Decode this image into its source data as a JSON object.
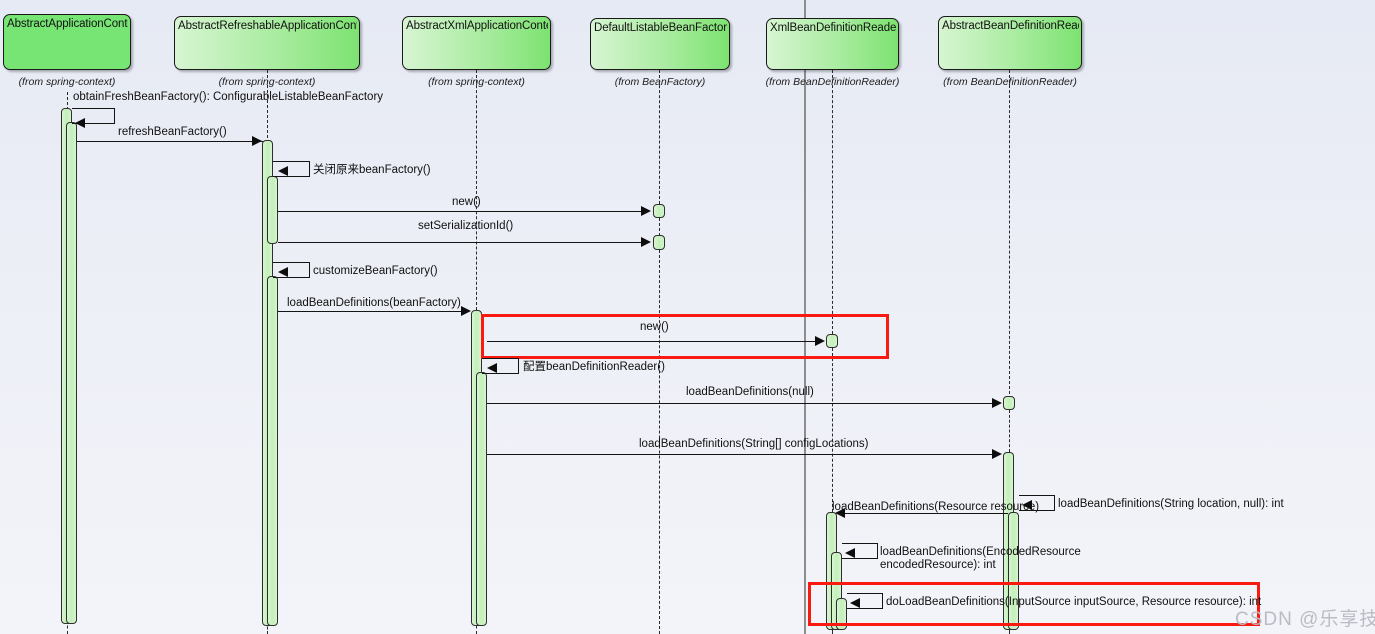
{
  "diagram": {
    "type": "uml-sequence-diagram",
    "background_color": "#e8ecf5",
    "highlight_color": "#fb1a12",
    "lifeline_fill": "#a9eca0"
  },
  "lifelines": [
    {
      "name": "AbstractApplicationContext",
      "package": "(from spring-context)"
    },
    {
      "name": "AbstractRefreshableApplicationContext",
      "package": "(from spring-context)"
    },
    {
      "name": "AbstractXmlApplicationContext",
      "package": "(from spring-context)"
    },
    {
      "name": "DefaultListableBeanFactory",
      "package": "(from BeanFactory)"
    },
    {
      "name": "XmlBeanDefinitionReader",
      "package": "(from BeanDefinitionReader)"
    },
    {
      "name": "AbstractBeanDefinitionReader",
      "package": "(from BeanDefinitionReader)"
    }
  ],
  "messages": [
    {
      "label": "obtainFreshBeanFactory(): ConfigurableListableBeanFactory",
      "kind": "self",
      "from": 0,
      "to": 0
    },
    {
      "label": "refreshBeanFactory()",
      "kind": "call",
      "from": 0,
      "to": 1
    },
    {
      "label": "关闭原来beanFactory()",
      "kind": "self",
      "from": 1,
      "to": 1
    },
    {
      "label": "new()",
      "kind": "create",
      "from": 1,
      "to": 3
    },
    {
      "label": "setSerializationId()",
      "kind": "call",
      "from": 1,
      "to": 3
    },
    {
      "label": "customizeBeanFactory()",
      "kind": "self",
      "from": 1,
      "to": 1
    },
    {
      "label": "loadBeanDefinitions(beanFactory)",
      "kind": "call",
      "from": 1,
      "to": 2
    },
    {
      "label": "new()",
      "kind": "create",
      "from": 2,
      "to": 4,
      "highlighted": true
    },
    {
      "label": "配置beanDefinitionReader()",
      "kind": "self",
      "from": 2,
      "to": 2
    },
    {
      "label": "loadBeanDefinitions(null)",
      "kind": "call",
      "from": 2,
      "to": 5
    },
    {
      "label": "loadBeanDefinitions(String[] configLocations)",
      "kind": "call",
      "from": 2,
      "to": 5
    },
    {
      "label": "loadBeanDefinitions(String location, null): int",
      "kind": "self",
      "from": 5,
      "to": 5
    },
    {
      "label": "loadBeanDefinitions(Resource resource)",
      "kind": "return-call",
      "from": 5,
      "to": 4
    },
    {
      "label": "loadBeanDefinitions(EncodedResource encodedResource): int",
      "kind": "self",
      "from": 4,
      "to": 4
    },
    {
      "label": "doLoadBeanDefinitions(InputSource inputSource, Resource resource): int",
      "kind": "self",
      "from": 4,
      "to": 4,
      "highlighted": true
    }
  ],
  "highlights": [
    {
      "note": "new() creating XmlBeanDefinitionReader"
    },
    {
      "note": "doLoadBeanDefinitions self call"
    }
  ],
  "watermark": {
    "text": "CSDN @乐享技术"
  }
}
